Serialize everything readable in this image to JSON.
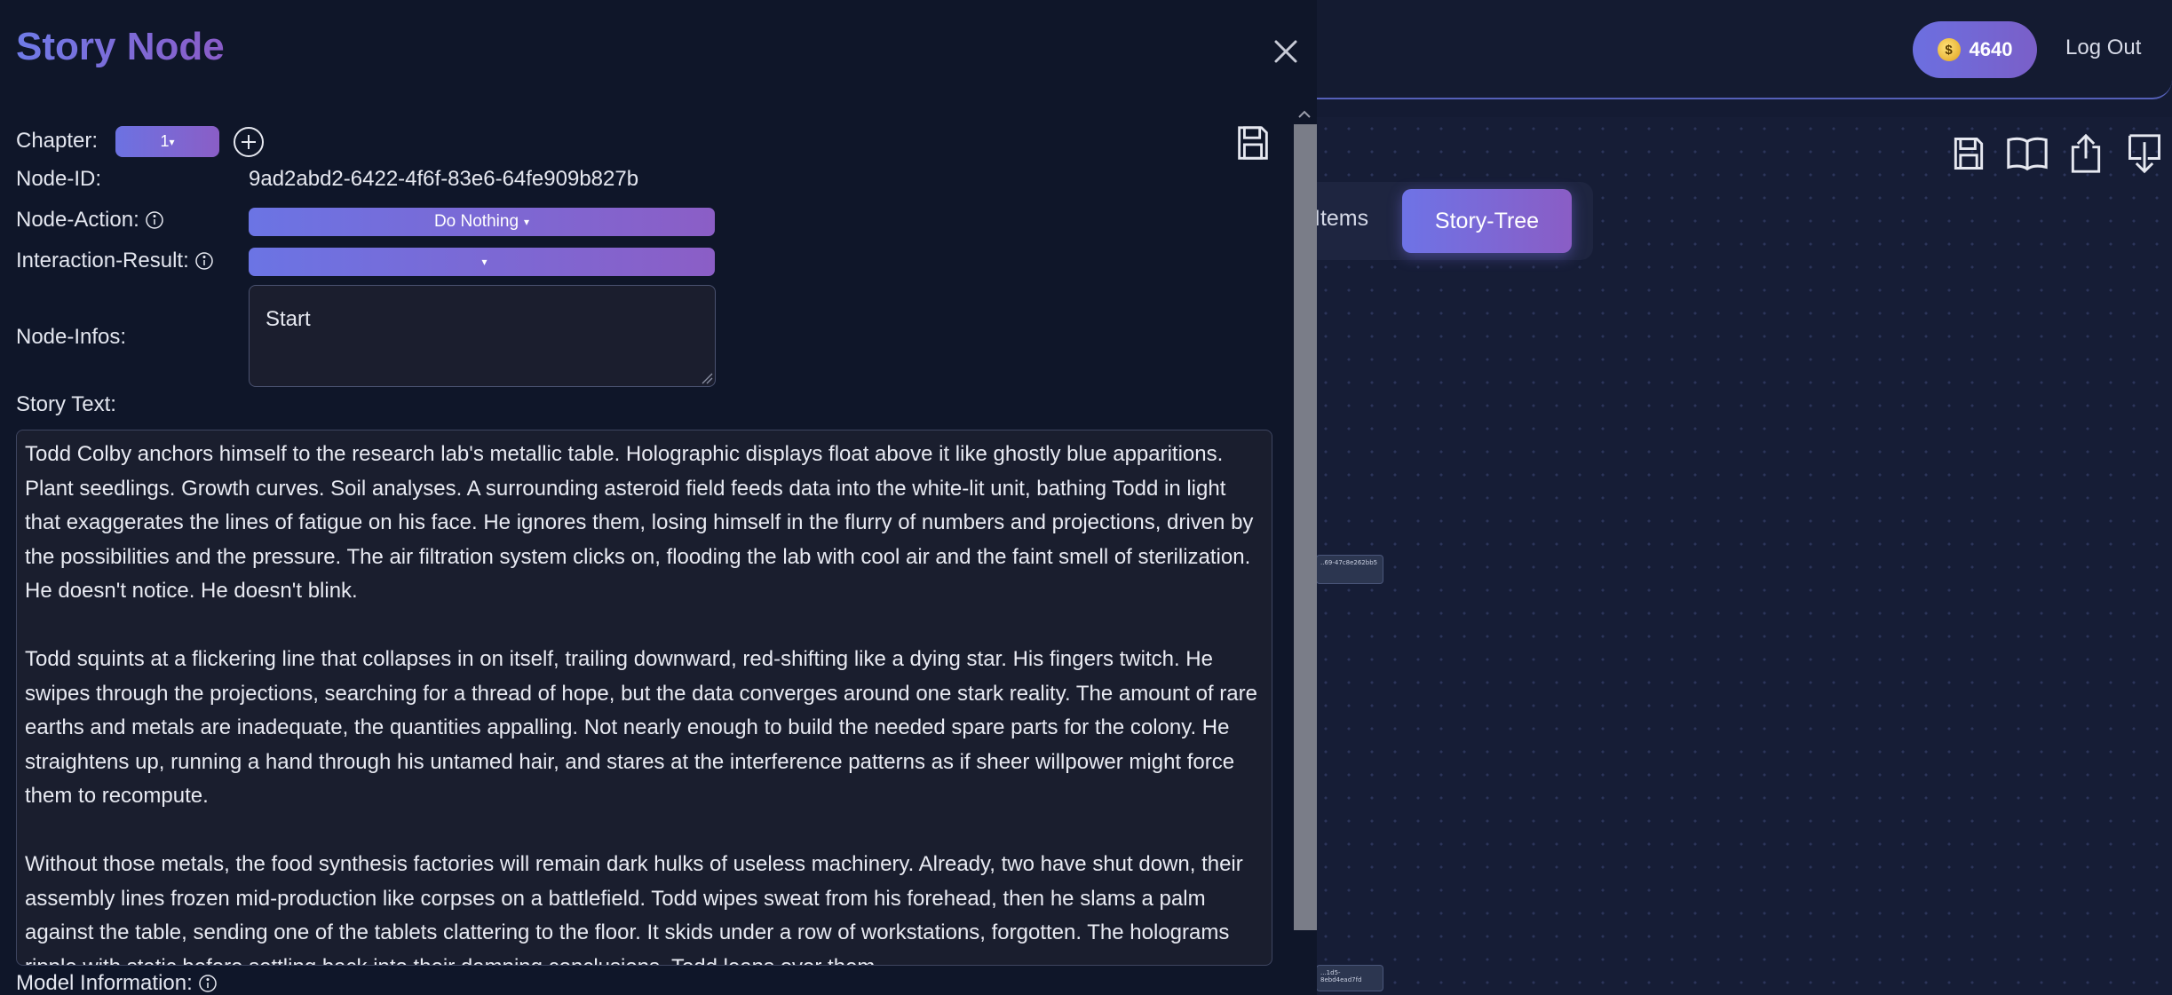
{
  "header": {
    "coins": "4640",
    "logout_label": "Log Out"
  },
  "toolbar": {
    "icons": [
      "save-icon",
      "book-icon",
      "export-icon",
      "import-icon"
    ]
  },
  "tabs": {
    "items_label": "Items",
    "story_tree_label": "Story-Tree"
  },
  "tree_nodes": [
    {
      "label": "..69-47c8e262bb5"
    },
    {
      "label": "...1d5-8ebd4ead7fd"
    }
  ],
  "panel": {
    "title": "Story Node",
    "chapter_label": "Chapter:",
    "chapter_value": "1",
    "node_id_label": "Node-ID:",
    "node_id_value": "9ad2abd2-6422-4f6f-83e6-64fe909b827b",
    "node_action_label": "Node-Action:",
    "node_action_value": "Do Nothing",
    "interaction_result_label": "Interaction-Result:",
    "interaction_result_value": "",
    "node_infos_label": "Node-Infos:",
    "node_infos_value": "Start",
    "story_text_label": "Story Text:",
    "story_paragraphs": [
      "Todd Colby anchors himself to the research lab's metallic table. Holographic displays float above it like ghostly blue apparitions. Plant seedlings. Growth curves. Soil analyses. A surrounding asteroid field feeds data into the white-lit unit, bathing Todd in light that exaggerates the lines of fatigue on his face. He ignores them, losing himself in the flurry of numbers and projections, driven by the possibilities and the pressure. The air filtration system clicks on, flooding the lab with cool air and the faint smell of sterilization. He doesn't notice. He doesn't blink.",
      "Todd squints at a flickering line that collapses in on itself, trailing downward, red-shifting like a dying star. His fingers twitch. He swipes through the projections, searching for a thread of hope, but the data converges around one stark reality. The amount of rare earths and metals are inadequate, the quantities appalling. Not nearly enough to build the needed spare parts for the colony. He straightens up, running a hand through his untamed hair, and stares at the interference patterns as if sheer willpower might force them to recompute.",
      "Without those metals, the food synthesis factories will remain dark hulks of useless machinery. Already, two have shut down, their assembly lines frozen mid-production like corpses on a battlefield. Todd wipes sweat from his forehead, then he slams a palm against the table, sending one of the tablets clattering to the floor. It skids under a row of workstations, forgotten. The holograms ripple with static before settling back into their damning conclusions. Todd leans over them"
    ],
    "model_info_label": "Model Information:"
  }
}
